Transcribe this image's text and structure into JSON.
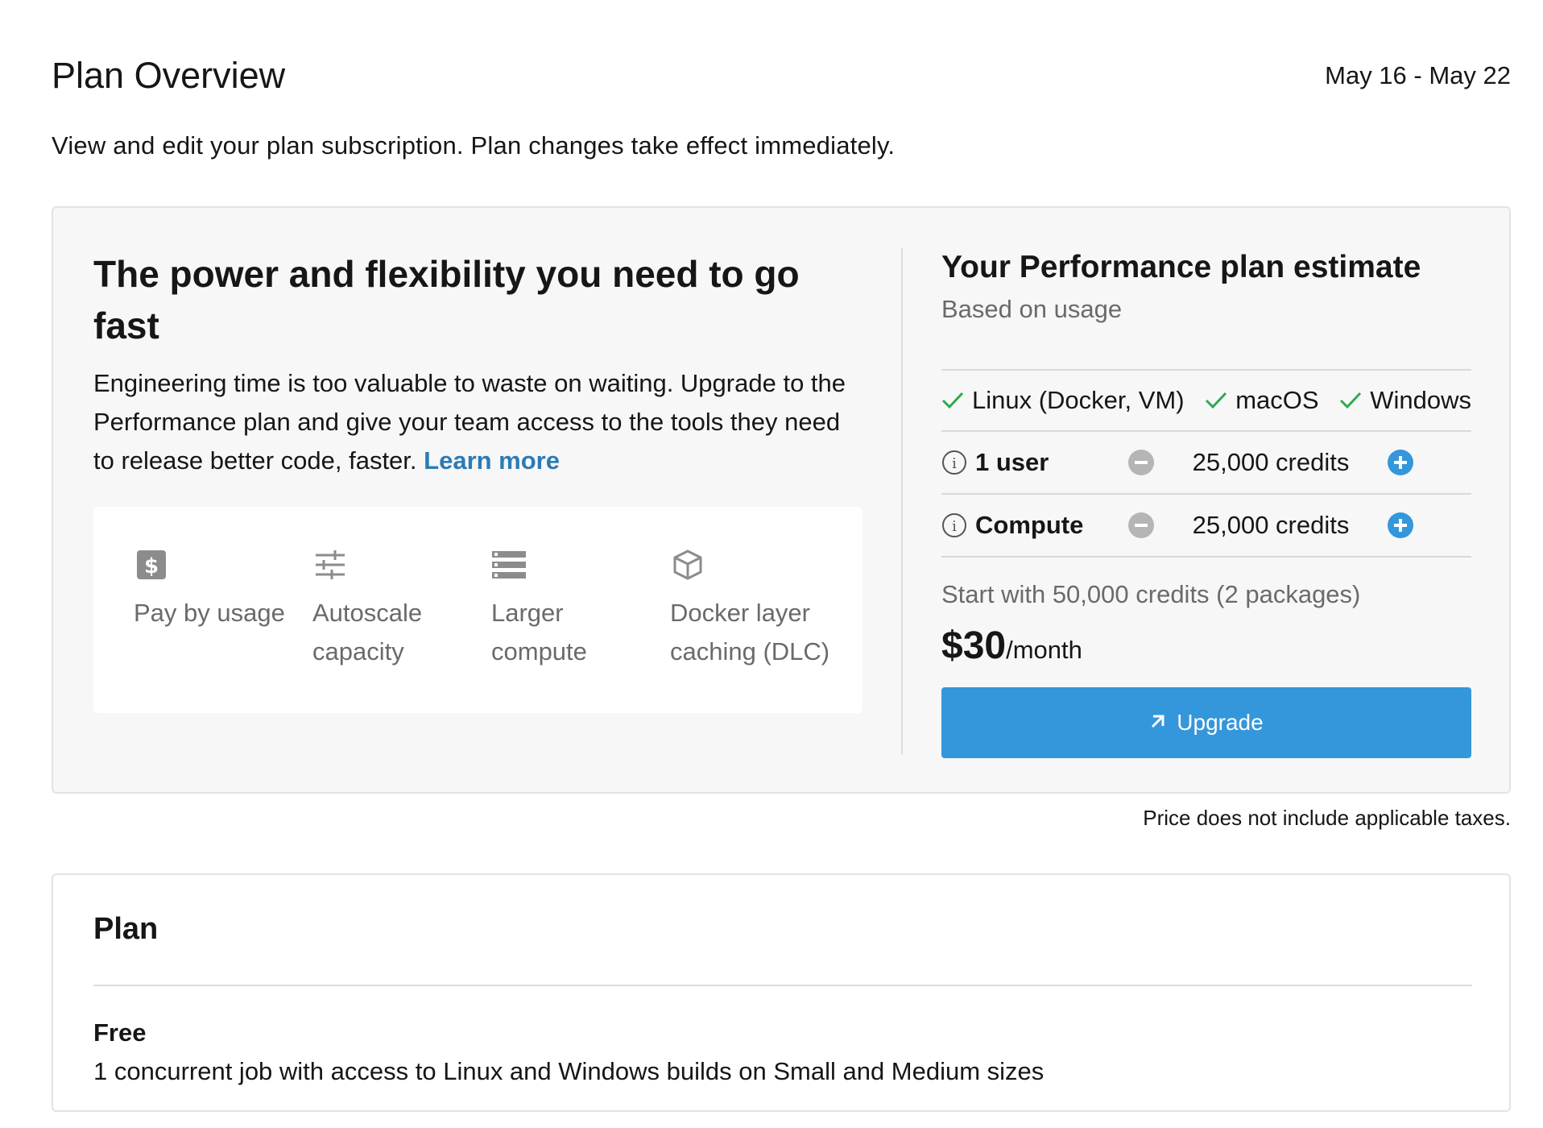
{
  "header": {
    "title": "Plan Overview",
    "date_range": "May 16 - May 22"
  },
  "subtitle": "View and edit your plan subscription. Plan changes take effect immediately.",
  "promo": {
    "heading": "The power and flexibility you need to go fast",
    "body": "Engineering time is too valuable to waste on waiting. Upgrade to the Performance plan and give your team access to the tools they need to release better code, faster.",
    "learn_more": "Learn more",
    "features": [
      {
        "icon": "dollar-icon",
        "label": "Pay by usage"
      },
      {
        "icon": "sliders-icon",
        "label": "Autoscale capacity"
      },
      {
        "icon": "server-icon",
        "label": "Larger compute"
      },
      {
        "icon": "cube-icon",
        "label": "Docker layer caching (DLC)"
      }
    ]
  },
  "estimate": {
    "title": "Your Performance plan estimate",
    "subtitle": "Based on usage",
    "os": [
      "Linux (Docker, VM)",
      "macOS",
      "Windows"
    ],
    "rows": [
      {
        "name": "1 user",
        "credits": "25,000 credits"
      },
      {
        "name": "Compute",
        "credits": "25,000 credits"
      }
    ],
    "start_text": "Start with 50,000 credits (2 packages)",
    "price": "$30",
    "per": "/month",
    "upgrade_label": "Upgrade",
    "colors": {
      "accent": "#3497db",
      "check": "#2fa84f",
      "link": "#2b7bb7"
    }
  },
  "tax_note": "Price does not include applicable taxes.",
  "plan": {
    "title": "Plan",
    "name": "Free",
    "description": "1 concurrent job with access to Linux and Windows builds on Small and Medium sizes"
  }
}
